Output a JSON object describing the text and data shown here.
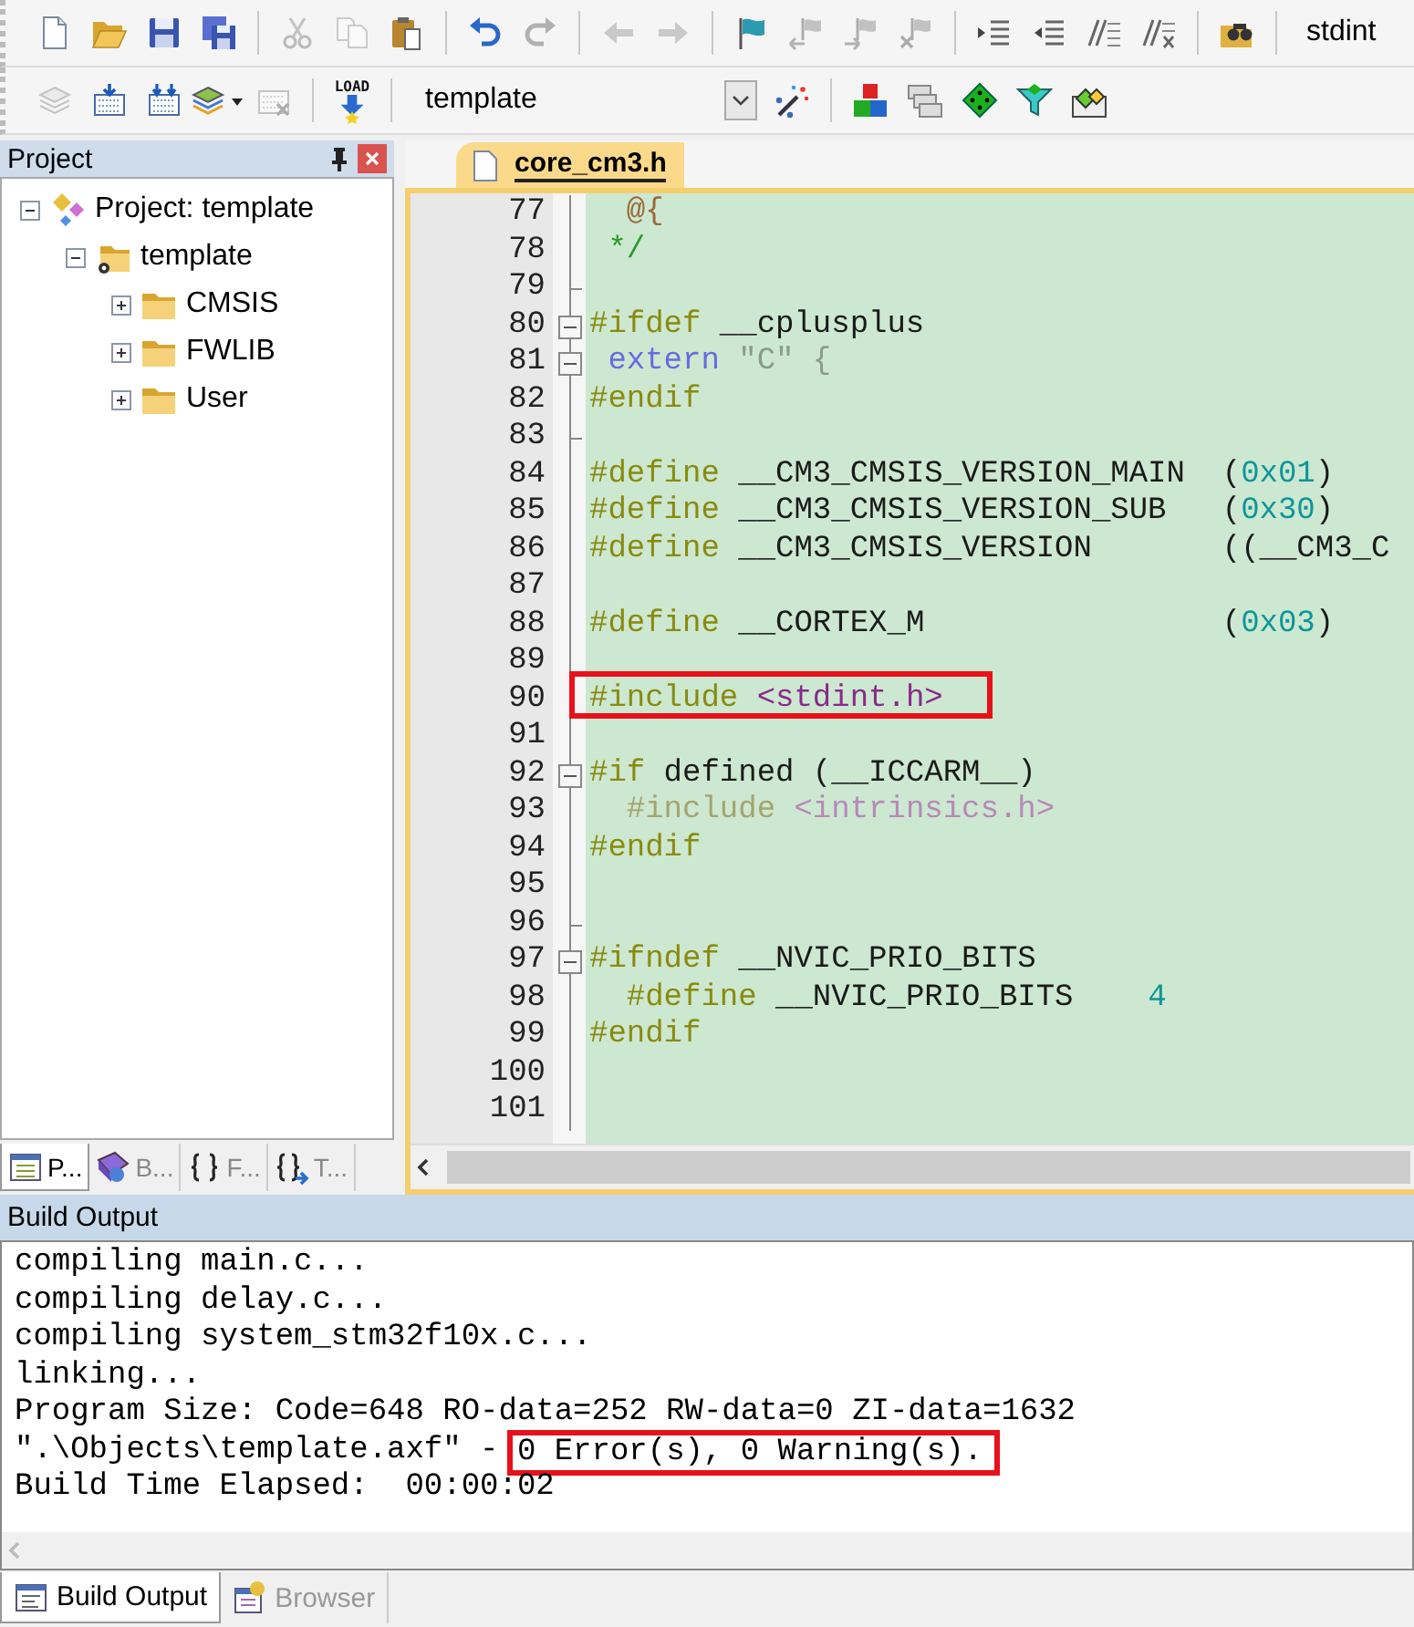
{
  "toolbar_1": {
    "groups": [
      [
        {
          "kind": "new",
          "disabled": false
        },
        {
          "kind": "open",
          "disabled": false
        },
        {
          "kind": "save",
          "disabled": false
        },
        {
          "kind": "save_all",
          "disabled": false
        }
      ],
      [
        {
          "kind": "cut",
          "disabled": true
        },
        {
          "kind": "copy",
          "disabled": true
        },
        {
          "kind": "paste",
          "disabled": false
        }
      ],
      [
        {
          "kind": "undo",
          "disabled": false
        },
        {
          "kind": "redo",
          "disabled": true
        }
      ],
      [
        {
          "kind": "back",
          "disabled": true
        },
        {
          "kind": "forward",
          "disabled": true
        }
      ],
      [
        {
          "kind": "bookmark",
          "disabled": false
        },
        {
          "kind": "bookmark_prev",
          "disabled": true
        },
        {
          "kind": "bookmark_next",
          "disabled": true
        },
        {
          "kind": "bookmark_clear",
          "disabled": true
        }
      ],
      [
        {
          "kind": "indent",
          "disabled": false
        },
        {
          "kind": "outdent",
          "disabled": false
        },
        {
          "kind": "comment",
          "disabled": false
        },
        {
          "kind": "uncomment",
          "disabled": false
        }
      ],
      [
        {
          "kind": "find_in_files",
          "disabled": false
        }
      ]
    ],
    "find_text": "stdint"
  },
  "toolbar_2": {
    "groups_before": [
      [
        {
          "kind": "translate",
          "disabled": true
        },
        {
          "kind": "build",
          "disabled": false
        },
        {
          "kind": "rebuild",
          "disabled": false
        },
        {
          "kind": "batch_build",
          "disabled": false
        },
        {
          "kind": "stop_build",
          "disabled": true
        }
      ],
      [
        {
          "kind": "download",
          "label": "LOAD",
          "disabled": false
        }
      ]
    ],
    "target": "template",
    "groups_after": [
      [
        {
          "kind": "wizard",
          "disabled": false
        }
      ],
      [
        {
          "kind": "components",
          "disabled": false
        },
        {
          "kind": "multi_project",
          "disabled": false
        },
        {
          "kind": "environment",
          "disabled": false
        },
        {
          "kind": "filter",
          "disabled": false
        },
        {
          "kind": "packs",
          "disabled": false
        }
      ]
    ]
  },
  "project_panel": {
    "title": "Project",
    "tree": [
      {
        "label": "Project: template",
        "kind": "project",
        "expanded": true,
        "children": [
          {
            "label": "template",
            "kind": "target",
            "expanded": true,
            "children": [
              {
                "label": "CMSIS",
                "kind": "group",
                "expanded": false
              },
              {
                "label": "FWLIB",
                "kind": "group",
                "expanded": false
              },
              {
                "label": "User",
                "kind": "group",
                "expanded": false
              }
            ]
          }
        ]
      }
    ],
    "tabs": [
      {
        "label": "P...",
        "kind": "project",
        "selected": true
      },
      {
        "label": "B...",
        "kind": "books",
        "selected": false
      },
      {
        "label": "F...",
        "kind": "functions",
        "selected": false
      },
      {
        "label": "T...",
        "kind": "templates",
        "selected": false
      }
    ]
  },
  "editor": {
    "tabs": [
      {
        "label": "core_cm3.h",
        "selected": true
      }
    ],
    "lines": [
      {
        "number": "77",
        "kind": "fold_line",
        "highlighted": false,
        "tokens": [
          {
            "text": "  @{",
            "kind": "doc"
          }
        ]
      },
      {
        "number": "78",
        "kind": "fold_line",
        "highlighted": false,
        "tokens": [
          {
            "text": " */",
            "kind": "comment"
          }
        ]
      },
      {
        "number": "79",
        "kind": "fold_end",
        "highlighted": false
      },
      {
        "number": "80",
        "kind": "fold_start",
        "highlighted": false,
        "tokens": [
          {
            "text": "#ifdef",
            "kind": "preprocessor"
          },
          {
            "text": " __cplusplus",
            "kind": "identifier"
          }
        ]
      },
      {
        "number": "81",
        "kind": "fold_start",
        "highlighted": false,
        "tokens": [
          {
            "text": " extern",
            "kind": "keyword"
          },
          {
            "text": " \"C\"",
            "kind": "string"
          },
          {
            "text": " {",
            "kind": "punct"
          }
        ]
      },
      {
        "number": "82",
        "kind": "fold_line",
        "highlighted": false,
        "tokens": [
          {
            "text": "#endif",
            "kind": "preprocessor"
          }
        ]
      },
      {
        "number": "83",
        "kind": "fold_end",
        "highlighted": false
      },
      {
        "number": "84",
        "kind": "fold_line",
        "highlighted": false,
        "tokens": [
          {
            "text": "#define",
            "kind": "preprocessor"
          },
          {
            "text": " __CM3_CMSIS_VERSION_MAIN  (",
            "kind": "identifier"
          },
          {
            "text": "0x01",
            "kind": "number"
          },
          {
            "text": ")",
            "kind": "identifier"
          }
        ]
      },
      {
        "number": "85",
        "kind": "fold_line",
        "highlighted": false,
        "tokens": [
          {
            "text": "#define",
            "kind": "preprocessor"
          },
          {
            "text": " __CM3_CMSIS_VERSION_SUB   (",
            "kind": "identifier"
          },
          {
            "text": "0x30",
            "kind": "number"
          },
          {
            "text": ")",
            "kind": "identifier"
          }
        ]
      },
      {
        "number": "86",
        "kind": "fold_line",
        "highlighted": false,
        "tokens": [
          {
            "text": "#define",
            "kind": "preprocessor"
          },
          {
            "text": " __CM3_CMSIS_VERSION       ((__CM3_C",
            "kind": "identifier"
          }
        ]
      },
      {
        "number": "87",
        "kind": "fold_line",
        "highlighted": false
      },
      {
        "number": "88",
        "kind": "fold_line",
        "highlighted": false,
        "tokens": [
          {
            "text": "#define",
            "kind": "preprocessor"
          },
          {
            "text": " __CORTEX_M                (",
            "kind": "identifier"
          },
          {
            "text": "0x03",
            "kind": "number"
          },
          {
            "text": ")",
            "kind": "identifier"
          }
        ]
      },
      {
        "number": "89",
        "kind": "fold_line",
        "highlighted": false
      },
      {
        "number": "90",
        "kind": "fold_line",
        "highlighted": true,
        "tokens": [
          {
            "text": "#include",
            "kind": "preprocessor"
          },
          {
            "text": " <stdint.h>",
            "kind": "header"
          }
        ]
      },
      {
        "number": "91",
        "kind": "fold_line",
        "highlighted": false
      },
      {
        "number": "92",
        "kind": "fold_start",
        "highlighted": false,
        "tokens": [
          {
            "text": "#if",
            "kind": "preprocessor"
          },
          {
            "text": " defined (__ICCARM__)",
            "kind": "identifier"
          }
        ]
      },
      {
        "number": "93",
        "kind": "fold_line",
        "highlighted": false,
        "tokens": [
          {
            "text": "  #include",
            "kind": "inactive"
          },
          {
            "text": " <intrinsics.h>",
            "kind": "inactive_header"
          }
        ]
      },
      {
        "number": "94",
        "kind": "fold_line",
        "highlighted": false,
        "tokens": [
          {
            "text": "#endif",
            "kind": "preprocessor"
          }
        ]
      },
      {
        "number": "95",
        "kind": "fold_line",
        "highlighted": false
      },
      {
        "number": "96",
        "kind": "fold_end",
        "highlighted": false
      },
      {
        "number": "97",
        "kind": "fold_start",
        "highlighted": false,
        "tokens": [
          {
            "text": "#ifndef",
            "kind": "preprocessor"
          },
          {
            "text": " __NVIC_PRIO_BITS",
            "kind": "identifier"
          }
        ]
      },
      {
        "number": "98",
        "kind": "fold_line",
        "highlighted": false,
        "tokens": [
          {
            "text": "  #define",
            "kind": "preprocessor"
          },
          {
            "text": " __NVIC_PRIO_BITS    ",
            "kind": "identifier"
          },
          {
            "text": "4",
            "kind": "number"
          }
        ]
      },
      {
        "number": "99",
        "kind": "fold_line",
        "highlighted": false,
        "tokens": [
          {
            "text": "#endif",
            "kind": "preprocessor"
          }
        ]
      },
      {
        "number": "100",
        "kind": "fold_line",
        "highlighted": false
      },
      {
        "number": "101",
        "kind": "fold_line",
        "highlighted": false
      }
    ]
  },
  "build_output": {
    "title": "Build Output",
    "lines": [
      {
        "parts": [
          {
            "text": "compiling main.c...",
            "boxed": false
          }
        ]
      },
      {
        "parts": [
          {
            "text": "compiling delay.c...",
            "boxed": false
          }
        ]
      },
      {
        "parts": [
          {
            "text": "compiling system_stm32f10x.c...",
            "boxed": false
          }
        ]
      },
      {
        "parts": [
          {
            "text": "linking...",
            "boxed": false
          }
        ]
      },
      {
        "parts": [
          {
            "text": "Program Size: Code=648 RO-data=252 RW-data=0 ZI-data=1632",
            "boxed": false
          }
        ]
      },
      {
        "parts": [
          {
            "text": "\".\\Objects\\template.axf\" - ",
            "boxed": false
          },
          {
            "text": "0 Error(s), 0 Warning(s).",
            "boxed": true
          }
        ]
      },
      {
        "parts": [
          {
            "text": "Build Time Elapsed:  00:00:02",
            "boxed": false
          }
        ]
      }
    ],
    "tabs": [
      {
        "label": "Build Output",
        "kind": "output",
        "selected": true
      },
      {
        "label": "Browser",
        "kind": "browser",
        "selected": false
      }
    ]
  }
}
